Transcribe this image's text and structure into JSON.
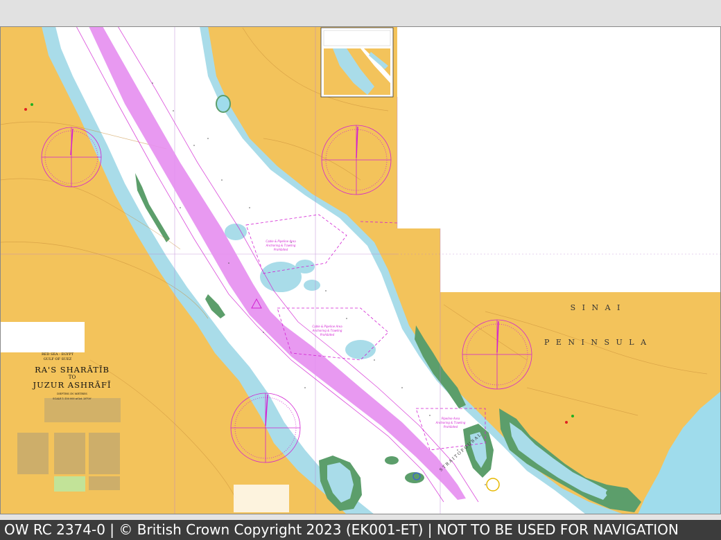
{
  "colors": {
    "land": "#f3c35b",
    "shallow_water": "#a9dce9",
    "deep_water": "#ffffff",
    "drying_zone": "#5c9e6b",
    "traffic_lane": "#e58ef0",
    "magenta_text": "#d21fd2",
    "caption_background": "#3c3c3c",
    "sea_open": "#9fdcec"
  },
  "chart": {
    "header_small_1": "RED SEA - EGYPT",
    "header_small_2": "GULF OF SUEZ",
    "title_line_1": "RA'S SHARĀTĪB",
    "title_connector": "TO",
    "title_line_2": "JUZUR ASHRĀFĪ",
    "depths_note": "DEPTHS IN METRES",
    "scale_note": "SCALE 1:150 000 at lat. 28°00'",
    "region_label_1": "S I N A I",
    "region_label_2": "P E N I N S U L A",
    "strait_label": "S T R A I T   O F   G U B A L"
  },
  "annotations": [
    {
      "line_1": "Cable & Pipeline Area",
      "line_2": "Anchoring & Trawling",
      "line_3": "Prohibited"
    },
    {
      "line_1": "Cable & Pipeline Area",
      "line_2": "Anchoring & Trawling",
      "line_3": "Prohibited"
    },
    {
      "line_1": "Pipeline Area",
      "line_2": "Anchoring & Trawling",
      "line_3": "Prohibited"
    }
  ],
  "caption": "OW RC 2374-0 | © British Crown Copyright 2023 (EK001-ET) | NOT TO BE USED FOR NAVIGATION"
}
